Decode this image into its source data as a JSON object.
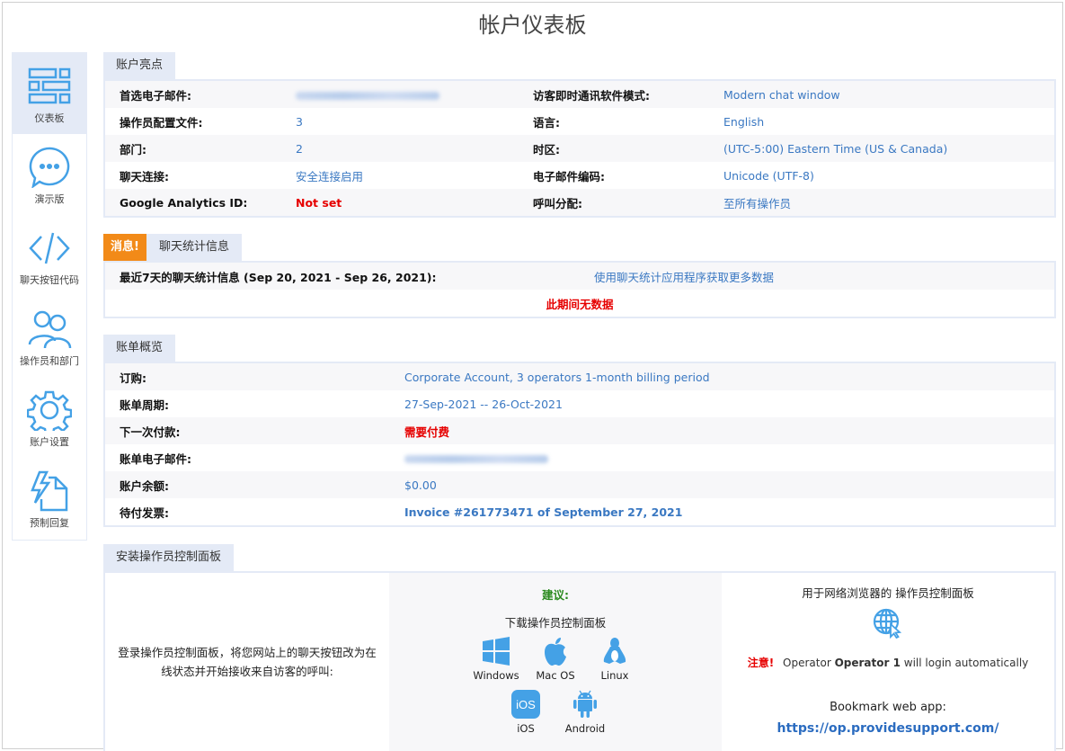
{
  "page_title": "帐户仪表板",
  "colors": {
    "accent": "#3a78c2",
    "icon_blue": "#44a1e6",
    "tab_bg": "#e4eaf6",
    "alert_orange": "#f28a18",
    "error_red": "#e60000",
    "suggest_green": "#2a8a1e"
  },
  "sidebar": {
    "items": [
      {
        "label": "仪表板",
        "icon": "dashboard-icon",
        "active": true
      },
      {
        "label": "演示版",
        "icon": "chat-bubble-icon"
      },
      {
        "label": "聊天按钮代码",
        "icon": "code-icon"
      },
      {
        "label": "操作员和部门",
        "icon": "users-icon"
      },
      {
        "label": "账户设置",
        "icon": "gear-icon"
      },
      {
        "label": "预制回复",
        "icon": "canned-response-icon"
      }
    ]
  },
  "highlights": {
    "tab": "账户亮点",
    "rows": [
      {
        "k1": "首选电子邮件:",
        "v1": "(blurred email)",
        "k2": "访客即时通讯软件模式:",
        "v2": "Modern chat window"
      },
      {
        "k1": "操作员配置文件:",
        "v1": "3",
        "k2": "语言:",
        "v2": "English"
      },
      {
        "k1": "部门:",
        "v1": "2",
        "k2": "时区:",
        "v2": "(UTC-5:00) Eastern Time (US & Canada)"
      },
      {
        "k1": "聊天连接:",
        "v1": "安全连接启用",
        "k2": "电子邮件编码:",
        "v2": "Unicode (UTF-8)"
      },
      {
        "k1": "Google Analytics ID:",
        "v1": "Not set",
        "k2": "呼叫分配:",
        "v2": "至所有操作员"
      }
    ]
  },
  "stats": {
    "alert_tab": "消息!",
    "tab": "聊天统计信息",
    "label": "最近7天的聊天统计信息 (Sep 20, 2021 - Sep 26, 2021):",
    "link": "使用聊天统计应用程序获取更多数据",
    "no_data": "此期间无数据"
  },
  "billing": {
    "tab": "账单概览",
    "rows": [
      {
        "k": "订购:",
        "v": "Corporate Account, 3 operators 1-month billing period"
      },
      {
        "k": "账单周期:",
        "v": "27-Sep-2021 -- 26-Oct-2021"
      },
      {
        "k": "下一次付款:",
        "v": "需要付费"
      },
      {
        "k": "账单电子邮件:",
        "v": "(blurred email)"
      },
      {
        "k": "账户余额:",
        "v": "$0.00"
      },
      {
        "k": "待付发票:",
        "v": "Invoice #261773471 of September 27, 2021"
      }
    ]
  },
  "install": {
    "tab": "安装操作员控制面板",
    "description": "登录操作员控制面板，将您网站上的聊天按钮改为在线状态并开始接收来自访客的呼叫:",
    "suggest": "建议:",
    "download": "下载操作员控制面板",
    "platforms": [
      "Windows",
      "Mac OS",
      "Linux",
      "iOS",
      "Android"
    ],
    "ios_badge": "iOS",
    "web_title": "用于网络浏览器的 操作员控制面板",
    "notice_label": "注意!",
    "notice_pre": "Operator ",
    "notice_operator": "Operator 1",
    "notice_post": " will login automatically",
    "bookmark": "Bookmark web app:",
    "web_url": "https://op.providesupport.com/"
  }
}
